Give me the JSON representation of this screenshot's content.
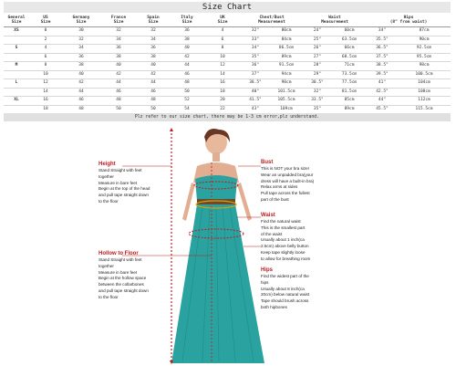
{
  "title": "Size Chart",
  "headers": {
    "general": [
      "General",
      "Size"
    ],
    "us": [
      "US",
      "Size"
    ],
    "germany": [
      "Germany",
      "Size"
    ],
    "france": [
      "France",
      "Size"
    ],
    "spain": [
      "Spain",
      "Size"
    ],
    "italy": [
      "Italy",
      "Size"
    ],
    "uk": [
      "UK",
      "Size"
    ],
    "chest": [
      "Chest/Bust",
      "Measurement"
    ],
    "waist": [
      "Waist",
      "Measurement"
    ],
    "hips": [
      "Hips",
      "(8\" from waist)"
    ]
  },
  "rows": [
    [
      "XS",
      "0",
      "30",
      "32",
      "32",
      "36",
      "4",
      "32\"",
      "80cm",
      "24\"",
      "60cm",
      "34\"",
      "87cm"
    ],
    [
      "",
      "2",
      "32",
      "34",
      "34",
      "38",
      "6",
      "33\"",
      "84cm",
      "25\"",
      "63.5cm",
      "35.5\"",
      "90cm"
    ],
    [
      "S",
      "4",
      "34",
      "36",
      "36",
      "40",
      "8",
      "34\"",
      "86.5cm",
      "26\"",
      "66cm",
      "36.5\"",
      "92.5cm"
    ],
    [
      "",
      "6",
      "36",
      "38",
      "38",
      "42",
      "10",
      "35\"",
      "89cm",
      "27\"",
      "68.5cm",
      "37.5\"",
      "95.5cm"
    ],
    [
      "M",
      "8",
      "38",
      "40",
      "40",
      "44",
      "12",
      "36\"",
      "91.5cm",
      "28\"",
      "71cm",
      "38.5\"",
      "98cm"
    ],
    [
      "",
      "10",
      "40",
      "42",
      "42",
      "46",
      "14",
      "37\"",
      "94cm",
      "29\"",
      "73.5cm",
      "39.5\"",
      "100.5cm"
    ],
    [
      "L",
      "12",
      "42",
      "44",
      "44",
      "48",
      "16",
      "38.5\"",
      "98cm",
      "30.5\"",
      "77.5cm",
      "41\"",
      "104cm"
    ],
    [
      "",
      "14",
      "44",
      "46",
      "46",
      "50",
      "18",
      "40\"",
      "101.5cm",
      "32\"",
      "81.5cm",
      "42.5\"",
      "108cm"
    ],
    [
      "XL",
      "16",
      "46",
      "48",
      "48",
      "52",
      "20",
      "41.5\"",
      "105.5cm",
      "33.5\"",
      "85cm",
      "44\"",
      "112cm"
    ],
    [
      "",
      "18",
      "48",
      "50",
      "50",
      "54",
      "22",
      "43\"",
      "109cm",
      "35\"",
      "89cm",
      "45.5\"",
      "115.5cm"
    ]
  ],
  "note": "Plz refer to our size chart, there may be 1-3 cm error,plz understand.",
  "guide": {
    "height": {
      "title": "Height",
      "lines": [
        "Stand Straight with feet",
        "together",
        "Measure in bare feet",
        "Begin at the top of the head",
        "and pull tape straight down",
        "to the floor"
      ]
    },
    "hollow": {
      "title": "Hollow to Floor",
      "lines": [
        "Stand Straight with feet",
        "together",
        "Measure in bare feet",
        "Begin at the hollow space",
        "between the collarbones",
        "and pull tape straight down",
        "to the floor"
      ]
    },
    "bust": {
      "title": "Bust",
      "lines": [
        "This is NOT your bra size!",
        "Wear an unpadded bra(your",
        "dress will have a built-in bra)",
        "Relax arms at sides",
        "Pull tape across the fullest",
        "part of the bust"
      ]
    },
    "waist": {
      "title": "Waist",
      "lines": [
        "Find the natural waist",
        "This is the smallest part",
        "of the waist",
        "Usually about 1 inch(ca",
        "2.5cm) above belly button",
        "Keep tape slightly loose",
        "to allow for breathing room"
      ]
    },
    "hips": {
      "title": "Hips",
      "lines": [
        "Find the widest part of the",
        "hips",
        "Usually about 8 inch(ca",
        "20cm) below natural waist",
        "Tape should brush across",
        "both hipbones"
      ]
    }
  },
  "colors": {
    "accent_red": "#c01b1b",
    "dress_teal": "#2aa3a0",
    "header_gray": "#e8e8e8"
  }
}
